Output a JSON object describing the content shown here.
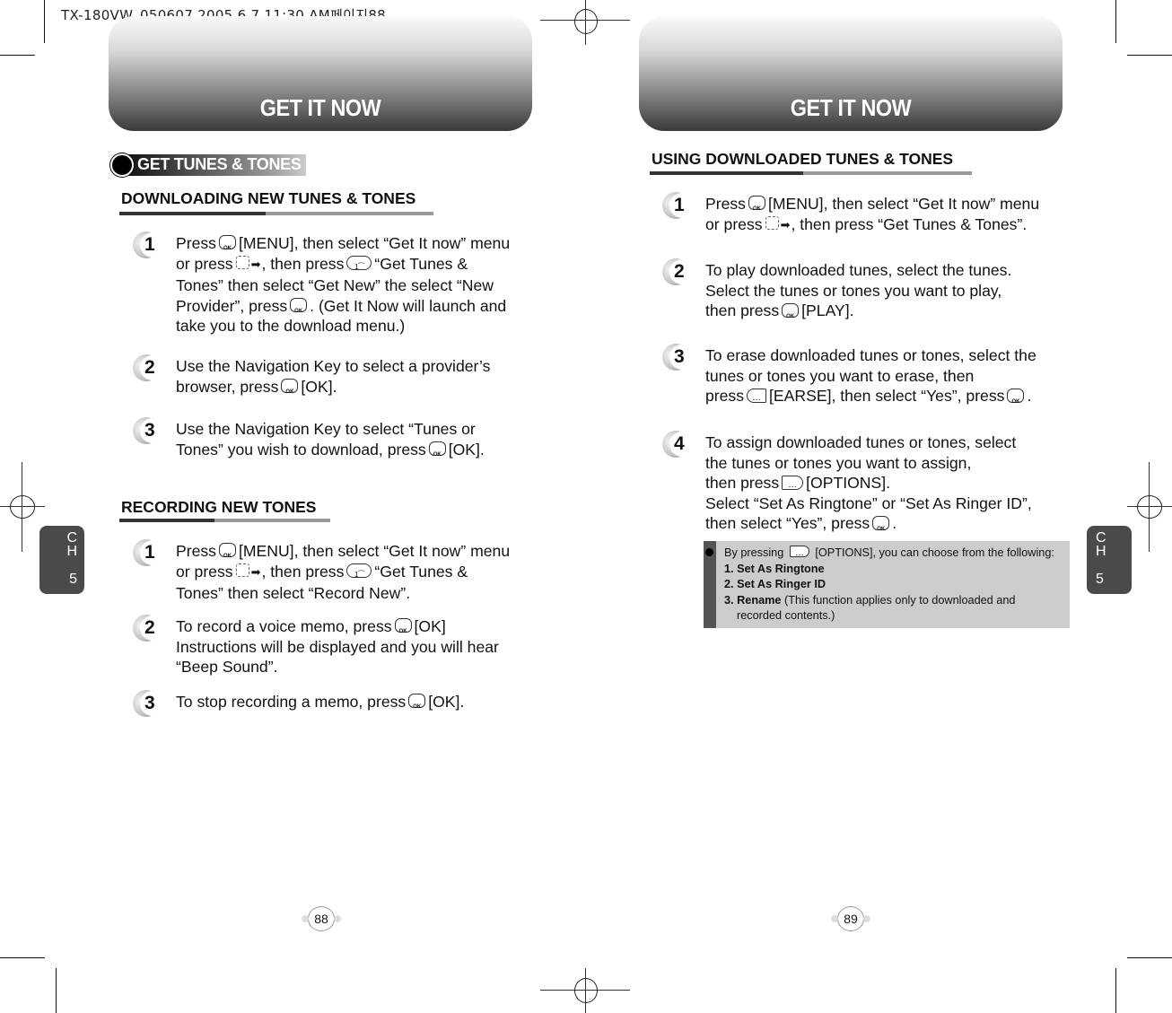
{
  "print_slug": "TX-180VW_050607  2005.6.7 11:30 AM페이지88",
  "left_page": {
    "banner_title": "GET IT NOW",
    "section_pill": "GET TUNES & TONES",
    "chapter_tab": {
      "c": "C",
      "h": "H",
      "num": "5"
    },
    "page_number": "88",
    "sections": [
      {
        "heading": "DOWNLOADING NEW TUNES & TONES",
        "steps": [
          {
            "num": "1",
            "lines": [
              [
                "Press",
                "ok-key",
                "[MENU], then select “Get It now” menu"
              ],
              [
                "or press",
                "nav-key",
                "arrow-right",
                ", then press",
                "num1-key",
                "“Get Tunes &"
              ],
              [
                "Tones” then select “Get New” the select “New"
              ],
              [
                "Provider”, press",
                "ok-key",
                ". (Get It Now will launch and"
              ],
              [
                "take you to the download menu.)"
              ]
            ]
          },
          {
            "num": "2",
            "lines": [
              [
                "Use the Navigation Key to select a provider’s"
              ],
              [
                "browser, press",
                "ok-key",
                "[OK]."
              ]
            ]
          },
          {
            "num": "3",
            "lines": [
              [
                "Use the Navigation Key to select “Tunes or"
              ],
              [
                "Tones” you wish to download, press",
                "ok-key",
                "[OK]."
              ]
            ]
          }
        ]
      },
      {
        "heading": "RECORDING NEW TONES",
        "steps": [
          {
            "num": "1",
            "lines": [
              [
                "Press",
                "ok-key",
                "[MENU], then select “Get It now” menu"
              ],
              [
                "or press",
                "nav-key",
                "arrow-right",
                ", then press",
                "num1-key",
                "“Get Tunes &"
              ],
              [
                "Tones” then select “Record New”."
              ]
            ]
          },
          {
            "num": "2",
            "lines": [
              [
                "To record a voice memo, press",
                "ok-key",
                "[OK]"
              ],
              [
                "Instructions will be displayed and you will hear"
              ],
              [
                "“Beep Sound”."
              ]
            ]
          },
          {
            "num": "3",
            "lines": [
              [
                "To stop recording a memo, press",
                "ok-key",
                "[OK]."
              ]
            ]
          }
        ]
      }
    ]
  },
  "right_page": {
    "banner_title": "GET IT NOW",
    "chapter_tab": {
      "c": "C",
      "h": "H",
      "num": "5"
    },
    "page_number": "89",
    "section": {
      "heading": "USING DOWNLOADED TUNES & TONES",
      "steps": [
        {
          "num": "1",
          "lines": [
            [
              "Press",
              "ok-key",
              "[MENU], then select “Get It now” menu"
            ],
            [
              "or press",
              "nav-key",
              "arrow-right",
              ", then press “Get Tunes & Tones”."
            ]
          ]
        },
        {
          "num": "2",
          "lines": [
            [
              "To play downloaded tunes, select the tunes."
            ],
            [
              "Select the tunes or tones you want to play,"
            ],
            [
              "then press",
              "ok-key",
              "[PLAY]."
            ]
          ]
        },
        {
          "num": "3",
          "lines": [
            [
              "To erase downloaded tunes or tones, select the"
            ],
            [
              "tunes or tones you want to erase, then"
            ],
            [
              "press",
              "soft-key",
              "[EARSE], then select “Yes”, press",
              "ok-key",
              "."
            ]
          ]
        },
        {
          "num": "4",
          "lines": [
            [
              "To assign downloaded tunes or tones, select"
            ],
            [
              "the tunes or tones you want to assign,"
            ],
            [
              "then press",
              "options-key",
              "[OPTIONS]."
            ],
            [
              "Select “Set As Ringtone” or “Set As Ringer ID”,"
            ],
            [
              "then select “Yes”, press",
              "ok-key",
              "."
            ]
          ]
        }
      ]
    },
    "note": {
      "intro_before": "By pressing",
      "intro_after": "[OPTIONS], you can choose from the following:",
      "items": [
        {
          "label": "1. Set As Ringtone",
          "desc": ""
        },
        {
          "label": "2. Set As Ringer ID",
          "desc": ""
        },
        {
          "label": "3. Rename",
          "desc": " (This function applies only to downloaded and"
        }
      ],
      "continuation": "recorded contents.)"
    }
  }
}
